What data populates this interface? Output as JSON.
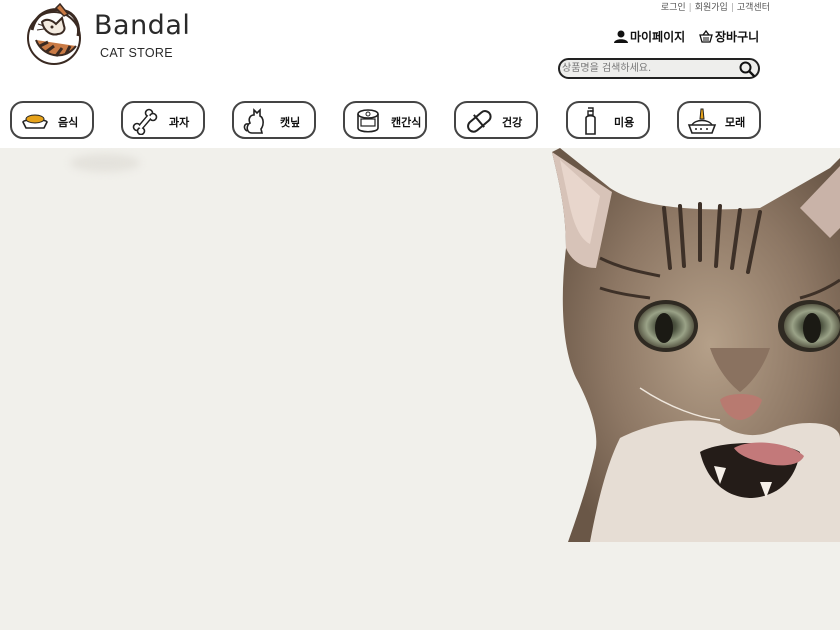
{
  "logo": {
    "name": "Bandal",
    "sub": "CAT STORE"
  },
  "util_links": [
    "로그인",
    "회원가입",
    "고객센터"
  ],
  "account": {
    "mypage": "마이페이지",
    "cart": "장바구니"
  },
  "search": {
    "placeholder": "상품명을 검색하세요."
  },
  "categories": [
    {
      "label": "음식",
      "icon": "food-bowl-icon"
    },
    {
      "label": "과자",
      "icon": "bone-icon"
    },
    {
      "label": "캣닢",
      "icon": "cat-silhouette-icon"
    },
    {
      "label": "캔간식",
      "icon": "can-icon"
    },
    {
      "label": "건강",
      "icon": "pill-icon"
    },
    {
      "label": "미용",
      "icon": "shampoo-bottle-icon"
    },
    {
      "label": "모래",
      "icon": "litter-box-icon"
    }
  ],
  "hero": {
    "background": "#f1f0eb",
    "image": "tabby-cat-photo"
  }
}
